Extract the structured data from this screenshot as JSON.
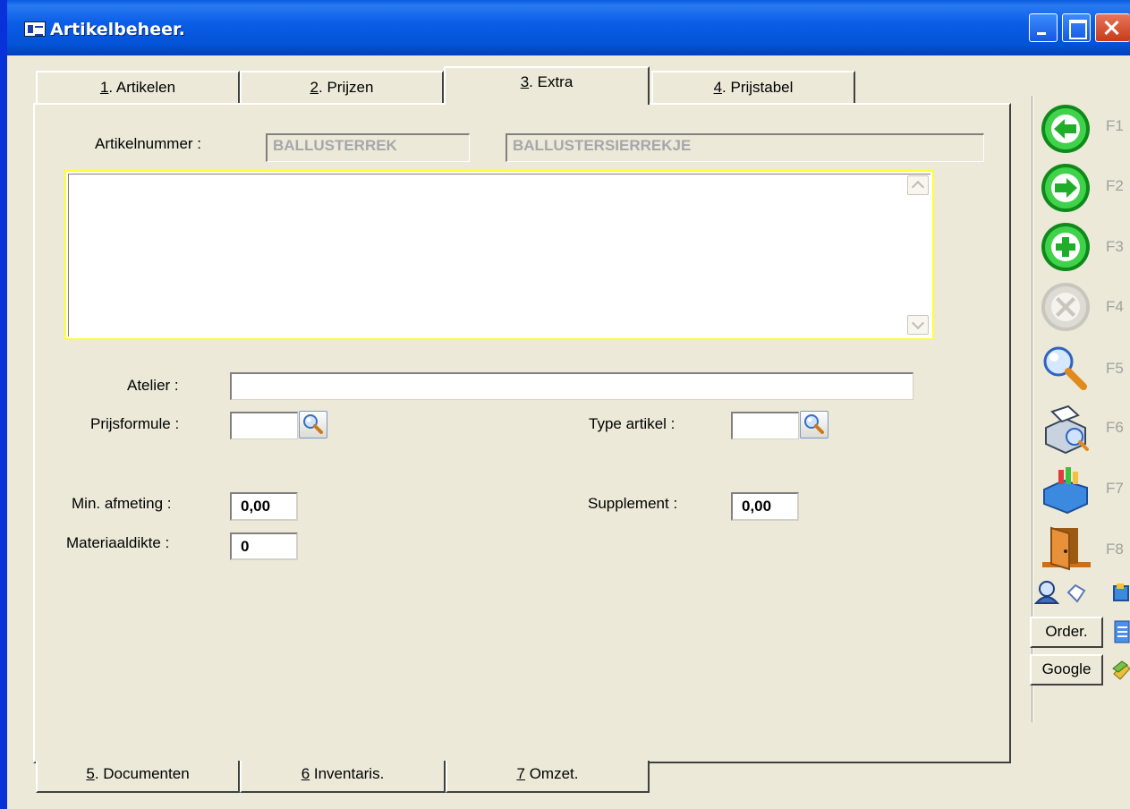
{
  "window": {
    "title": "Artikelbeheer."
  },
  "tabs_top": [
    {
      "key": "1",
      "rest": ". Artikelen"
    },
    {
      "key": "2",
      "rest": ". Prijzen"
    },
    {
      "key": "3",
      "rest": ". Extra"
    },
    {
      "key": "4",
      "rest": ". Prijstabel"
    }
  ],
  "active_tab": "3. Extra",
  "tabs_bottom": [
    {
      "key": "5",
      "rest": ". Documenten"
    },
    {
      "key": "6",
      "rest": " Inventaris."
    },
    {
      "key": "7",
      "rest": " Omzet."
    }
  ],
  "form": {
    "artikelnummer_label": "Artikelnummer :",
    "artikelnummer_code": "BALLUSTERREK",
    "artikelnummer_desc": "BALLUSTERSIERREKJE",
    "atelier_label": "Atelier :",
    "atelier_value": "",
    "prijsformule_label": "Prijsformule :",
    "prijsformule_value": "",
    "type_artikel_label": "Type artikel :",
    "type_artikel_value": "",
    "min_afmeting_label": "Min. afmeting :",
    "min_afmeting_value": "0,00",
    "supplement_label": "Supplement :",
    "supplement_value": "0,00",
    "materiaaldikte_label": "Materiaaldikte :",
    "materiaaldikte_value": "0"
  },
  "toolbar": {
    "keys": [
      "F1",
      "F2",
      "F3",
      "F4",
      "F5",
      "F6",
      "F7",
      "F8"
    ],
    "order_label": "Order.",
    "google_label": "Google"
  },
  "colors": {
    "titlebar": "#0a5be0",
    "green_button": "#1fae2a",
    "memo_focus": "#ffff33"
  }
}
